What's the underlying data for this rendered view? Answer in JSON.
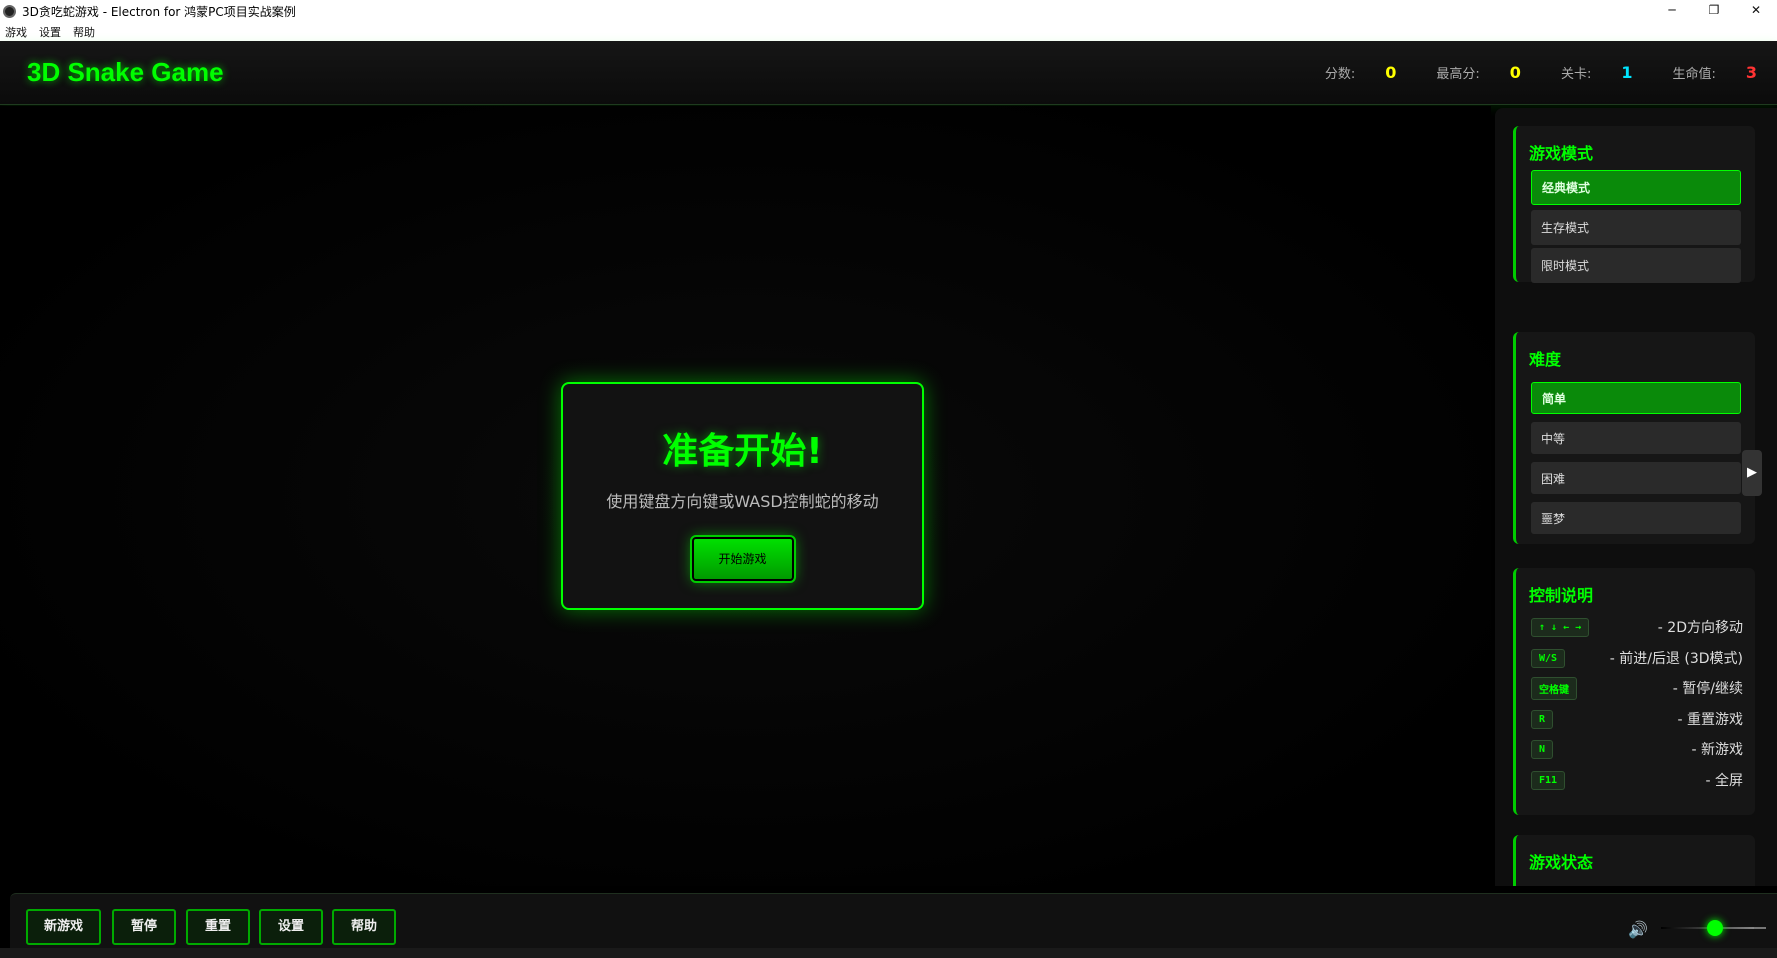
{
  "window": {
    "title": "3D贪吃蛇游戏 - Electron for 鸿蒙PC项目实战案例",
    "minimize": "─",
    "restore": "❐",
    "close": "✕"
  },
  "menu": [
    "游戏",
    "设置",
    "帮助"
  ],
  "header": {
    "title": "3D Snake Game",
    "stats": [
      {
        "label": "分数:",
        "value": "0",
        "color": "#ffff00"
      },
      {
        "label": "最高分:",
        "value": "0",
        "color": "#ffff00"
      },
      {
        "label": "关卡:",
        "value": "1",
        "color": "#00e5ff"
      },
      {
        "label": "生命值:",
        "value": "3",
        "color": "#ff3333"
      }
    ]
  },
  "modal": {
    "title": "准备开始!",
    "text": "使用键盘方向键或WASD控制蛇的移动",
    "start_button": "开始游戏"
  },
  "sidebar": {
    "mode": {
      "title": "游戏模式",
      "options": [
        "经典模式",
        "生存模式",
        "限时模式"
      ],
      "selected": "经典模式"
    },
    "difficulty": {
      "title": "难度",
      "options": [
        "简单",
        "中等",
        "困难",
        "噩梦"
      ],
      "selected": "简单",
      "scroll_arrow": "▶"
    },
    "controls": {
      "title": "控制说明",
      "items": [
        {
          "key": "↑ ↓ ← →",
          "desc": "- 2D方向移动"
        },
        {
          "key": "W/S",
          "desc": "- 前进/后退 (3D模式)"
        },
        {
          "key": "空格键",
          "desc": "- 暂停/继续"
        },
        {
          "key": "R",
          "desc": "- 重置游戏"
        },
        {
          "key": "N",
          "desc": "- 新游戏"
        },
        {
          "key": "F11",
          "desc": "- 全屏"
        }
      ]
    },
    "status": {
      "title": "游戏状态"
    }
  },
  "bottom": {
    "buttons": [
      "新游戏",
      "暂停",
      "重置",
      "设置",
      "帮助"
    ],
    "volume_icon": "🔊",
    "volume_level": 0.58
  }
}
